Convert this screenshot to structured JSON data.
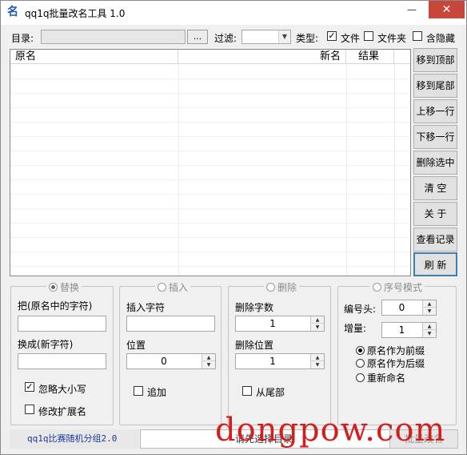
{
  "window": {
    "title": "qq1q批量改名工具 1.0",
    "icon_glyph": "名",
    "minimize_glyph": "—",
    "maximize_glyph": "□",
    "close_glyph": "✕"
  },
  "toolbar": {
    "dir_label": "目录:",
    "dir_value": "",
    "browse_label": "...",
    "filter_label": "过滤:",
    "filter_value": "",
    "type_label": "类型:",
    "type_options": [
      {
        "label": "文件",
        "checked": true
      },
      {
        "label": "文件夹",
        "checked": false
      },
      {
        "label": "含隐藏",
        "checked": false
      }
    ]
  },
  "list": {
    "columns": [
      "原名",
      "新名",
      "结果"
    ],
    "rows": []
  },
  "actions": [
    "移到顶部",
    "移到尾部",
    "上移一行",
    "下移一行",
    "删除选中",
    "清  空",
    "关  于",
    "查看记录",
    "刷  新"
  ],
  "replace_group": {
    "title": "替换",
    "selected": true,
    "from_label": "把(原名中的字符)",
    "from_value": "",
    "to_label": "换成(新字符)",
    "to_value": "",
    "ignore_case_label": "忽略大小写",
    "ignore_case_checked": true,
    "modify_ext_label": "修改扩展名",
    "modify_ext_checked": false
  },
  "insert_group": {
    "title": "插入",
    "selected": false,
    "chars_label": "插入字符",
    "chars_value": "",
    "position_label": "位置",
    "position_value": "0",
    "append_label": "追加",
    "append_checked": false
  },
  "delete_group": {
    "title": "删除",
    "selected": false,
    "count_label": "删除字数",
    "count_value": "1",
    "position_label": "删除位置",
    "position_value": "1",
    "from_end_label": "从尾部",
    "from_end_checked": false
  },
  "sequence_group": {
    "title": "序号模式",
    "selected": false,
    "prefix_label": "编号头:",
    "prefix_value": "0",
    "step_label": "增量:",
    "step_value": "1",
    "modes": [
      {
        "label": "原名作为前缀",
        "selected": true
      },
      {
        "label": "原名作为后缀",
        "selected": false
      },
      {
        "label": "重新命名",
        "selected": false
      }
    ]
  },
  "status": {
    "left_text": "qq1q比赛随机分组2.0",
    "message": "请先选择目录",
    "run_button": "批量改名"
  },
  "watermark": "dongpow.com"
}
